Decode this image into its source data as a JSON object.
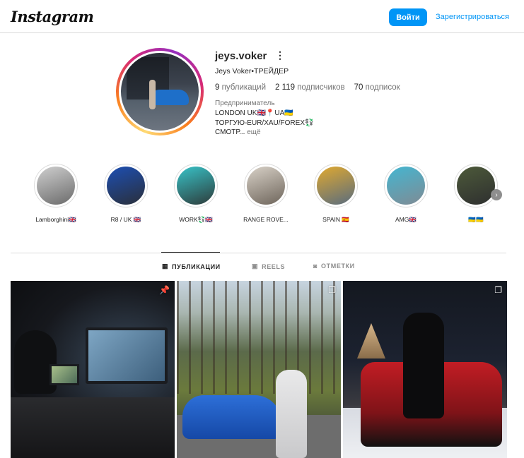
{
  "header": {
    "logo": "Instagram",
    "login_label": "Войти",
    "signup_label": "Зарегистрироваться"
  },
  "profile": {
    "username": "jeys.voker",
    "more_glyph": "⋮",
    "full_name": "Jeys Voker•ТРЕЙДЕР",
    "stats": {
      "posts_count": "9",
      "posts_label": "публикаций",
      "followers_count": "2 119",
      "followers_label": "подписчиков",
      "following_count": "70",
      "following_label": "подписок"
    },
    "category": "Предприниматель",
    "bio_lines": [
      "LONDON UK🇬🇧📍UA🇺🇦",
      "ТОРГУЮ-EUR/XAU/FOREX💱",
      "СМОТР..."
    ],
    "bio_more": "ещё"
  },
  "highlights": [
    {
      "label": "Lamborghini🇬🇧",
      "colors": [
        "#cfcfcf",
        "#6b6b6b"
      ]
    },
    {
      "label": "R8 / UK 🇬🇧",
      "colors": [
        "#1d4fb3",
        "#2a2f3a"
      ]
    },
    {
      "label": "WORK💱🇬🇧",
      "colors": [
        "#38c3c8",
        "#2d3b3a"
      ]
    },
    {
      "label": "RANGE ROVE...",
      "colors": [
        "#d8d1c7",
        "#6e655b"
      ]
    },
    {
      "label": "SPAIN 🇪🇸",
      "colors": [
        "#e0a930",
        "#596c7e"
      ]
    },
    {
      "label": "AMG🇬🇧",
      "colors": [
        "#44b6d1",
        "#7f8b94"
      ]
    },
    {
      "label": "🇺🇦🇺🇦",
      "colors": [
        "#4d5a3a",
        "#2e2f2f"
      ]
    }
  ],
  "tabs": [
    {
      "label": "ПУБЛИКАЦИИ",
      "icon": "grid-icon",
      "glyph": "▦",
      "active": true
    },
    {
      "label": "REELS",
      "icon": "reels-icon",
      "glyph": "▣",
      "active": false
    },
    {
      "label": "ОТМЕТКИ",
      "icon": "tagged-icon",
      "glyph": "◙",
      "active": false
    }
  ],
  "posts": [
    {
      "icon": "pin-icon",
      "glyph": "📌"
    },
    {
      "icon": "carousel-icon",
      "glyph": "❐"
    },
    {
      "icon": "carousel-icon",
      "glyph": "❐"
    }
  ]
}
